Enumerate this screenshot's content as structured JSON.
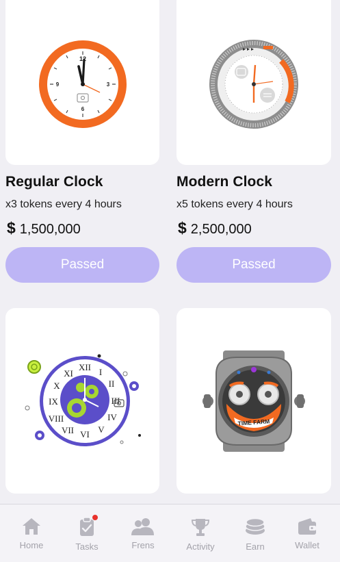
{
  "cards": [
    {
      "title": "Regular Clock",
      "desc": "x3 tokens every 4 hours",
      "currency": "$",
      "price": "1,500,000",
      "button": "Passed",
      "image": "regular-clock-illustration"
    },
    {
      "title": "Modern Clock",
      "desc": "x5 tokens every 4 hours",
      "currency": "$",
      "price": "2,500,000",
      "button": "Passed",
      "image": "modern-clock-illustration"
    },
    {
      "image": "gear-roman-clock-illustration"
    },
    {
      "image": "time-farm-watch-illustration",
      "watch_text": "TIME FARM"
    }
  ],
  "regular_clock_numerals": [
    "12",
    "3",
    "6",
    "9"
  ],
  "roman_numerals": [
    "XII",
    "I",
    "II",
    "III",
    "IV",
    "V",
    "VI",
    "VII",
    "VIII",
    "IX",
    "X",
    "XI"
  ],
  "tabbar": {
    "tabs": [
      {
        "label": "Home",
        "icon": "home-icon"
      },
      {
        "label": "Tasks",
        "icon": "tasks-icon"
      },
      {
        "label": "Frens",
        "icon": "frens-icon"
      },
      {
        "label": "Activity",
        "icon": "trophy-icon"
      },
      {
        "label": "Earn",
        "icon": "coins-icon"
      },
      {
        "label": "Wallet",
        "icon": "wallet-icon"
      }
    ]
  },
  "colors": {
    "accent": "#bdb5f5",
    "orange": "#f26a21",
    "purple": "#5b4ec9",
    "badge": "#e8322d"
  }
}
